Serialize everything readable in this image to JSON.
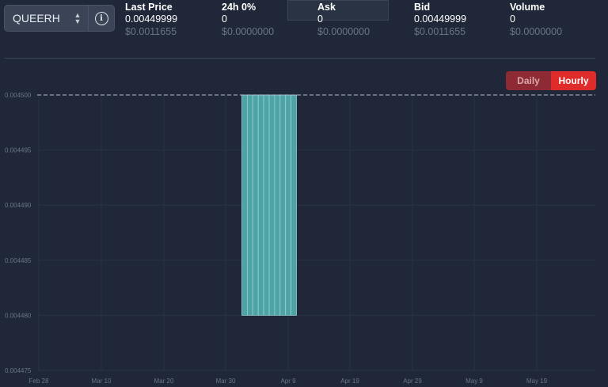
{
  "pair": {
    "name": "QUEERH",
    "info_icon": "info-icon",
    "chevron_icon": "chevron-updown-icon"
  },
  "stats": {
    "last_price": {
      "label": "Last Price",
      "value": "0.00449999",
      "usd": "$0.0011655"
    },
    "change_24h": {
      "label": "24h 0%",
      "value": "0",
      "usd": "$0.0000000"
    },
    "ask": {
      "label": "Ask",
      "value": "0",
      "usd": "$0.0000000"
    },
    "bid": {
      "label": "Bid",
      "value": "0.00449999",
      "usd": "$0.0011655"
    },
    "volume": {
      "label": "Volume",
      "value": "0",
      "usd": "$0.0000000"
    }
  },
  "toggle": {
    "daily": "Daily",
    "hourly": "Hourly",
    "active": "Hourly"
  },
  "colors": {
    "background": "#1f2738",
    "bar_fill": "#4fa3a5",
    "bar_stroke": "#8fd3d5",
    "active_red": "#e02b2b"
  },
  "chart_data": {
    "type": "bar",
    "x_tick_labels": [
      "Feb 28",
      "Mar 10",
      "Mar 20",
      "Mar 30",
      "Apr 9",
      "Apr 19",
      "Apr 29",
      "May 9",
      "May 19"
    ],
    "y_tick_labels": [
      "0.004500",
      "0.004495",
      "0.004490",
      "0.004485",
      "0.004480",
      "0.004475"
    ],
    "ylim": [
      0.004475,
      0.0045
    ],
    "bars": [
      {
        "low": 0.00448,
        "high": 0.0045
      },
      {
        "low": 0.00448,
        "high": 0.0045
      },
      {
        "low": 0.00448,
        "high": 0.0045
      },
      {
        "low": 0.00448,
        "high": 0.0045
      },
      {
        "low": 0.00448,
        "high": 0.0045
      },
      {
        "low": 0.00448,
        "high": 0.0045
      },
      {
        "low": 0.00448,
        "high": 0.0045
      },
      {
        "low": 0.00448,
        "high": 0.0045
      },
      {
        "low": 0.00448,
        "high": 0.0045
      },
      {
        "low": 0.00448,
        "high": 0.0045
      }
    ],
    "reference_line": 0.0045,
    "grid": true
  }
}
